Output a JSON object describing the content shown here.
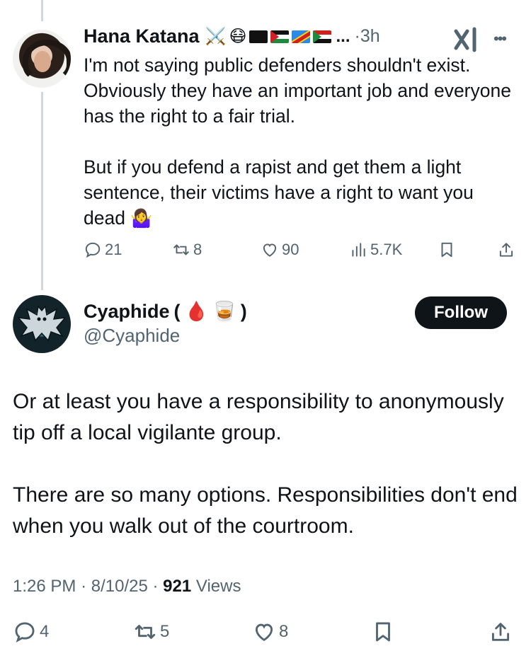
{
  "tweet1": {
    "author_name": "Hana Katana",
    "emojis": [
      "⚔️",
      "😷"
    ],
    "flag_icons": [
      "black-flag-icon",
      "palestine-flag-icon",
      "drc-flag-icon",
      "sudan-flag-icon"
    ],
    "name_truncation": "...",
    "separator": "·",
    "time": "3h",
    "text": "I'm not saying public defenders shouldn't exist. Obviously they have an important job and everyone has the right to a fair trial.\n\nBut if you defend a rapist and get them a light sentence, their victims have a right to want you dead ",
    "text_emoji": "🤷‍♀️",
    "stats": {
      "replies": "21",
      "reposts": "8",
      "likes": "90",
      "views": "5.7K"
    }
  },
  "tweet2": {
    "author_name": "Cyaphide",
    "name_open": "(",
    "name_emojis": [
      "🩸",
      "🥃"
    ],
    "name_close": ")",
    "handle": "@Cyaphide",
    "follow_label": "Follow",
    "text": "Or at least you have a responsibility to anonymously tip off a local vigilante group.\n\nThere are so many options. Responsibilities don't end when you walk out of the courtroom.",
    "time": "1:26 PM",
    "date": "8/10/25",
    "separator": "·",
    "views_count": "921",
    "views_label": "Views",
    "stats": {
      "replies": "4",
      "reposts": "5",
      "likes": "8"
    }
  },
  "colors": {
    "text": "#0f1419",
    "secondary": "#536471",
    "thread_line": "#cfd9de",
    "follow_bg": "#0f1419"
  }
}
